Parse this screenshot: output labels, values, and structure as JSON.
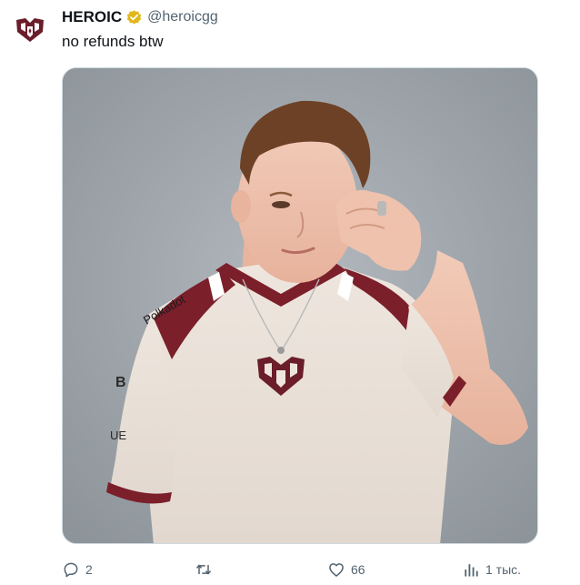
{
  "tweet": {
    "display_name": "HEROIC",
    "handle": "@heroicgg",
    "verified": true,
    "verified_color": "#e2b719",
    "text": "no refunds btw",
    "avatar_icon": "heroic-logo-icon",
    "brand_color": "#6b1d2a"
  },
  "actions": {
    "reply_count": "2",
    "retweet_count": "",
    "like_count": "66",
    "views_count": "1 тыс."
  }
}
